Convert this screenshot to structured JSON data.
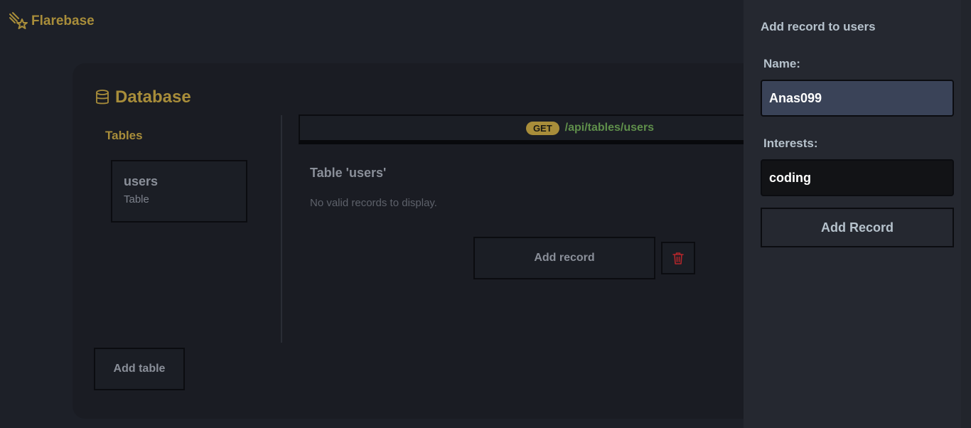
{
  "app": {
    "brand_name": "Flarebase",
    "brand_color": "#a88d3a"
  },
  "database": {
    "title": "Database",
    "tables_heading": "Tables",
    "tables": [
      {
        "name": "users",
        "type": "Table"
      }
    ],
    "add_table_label": "Add table"
  },
  "endpoint": {
    "method": "GET",
    "path": "/api/tables/users"
  },
  "table_view": {
    "title": "Table 'users'",
    "empty_message": "No valid records to display.",
    "add_record_label": "Add record",
    "delete_icon": "trash-icon"
  },
  "panel": {
    "title": "Add record to users",
    "fields": [
      {
        "label": "Name:",
        "value": "Anas099"
      },
      {
        "label": "Interests:",
        "value": "coding"
      }
    ],
    "submit_label": "Add Record"
  }
}
